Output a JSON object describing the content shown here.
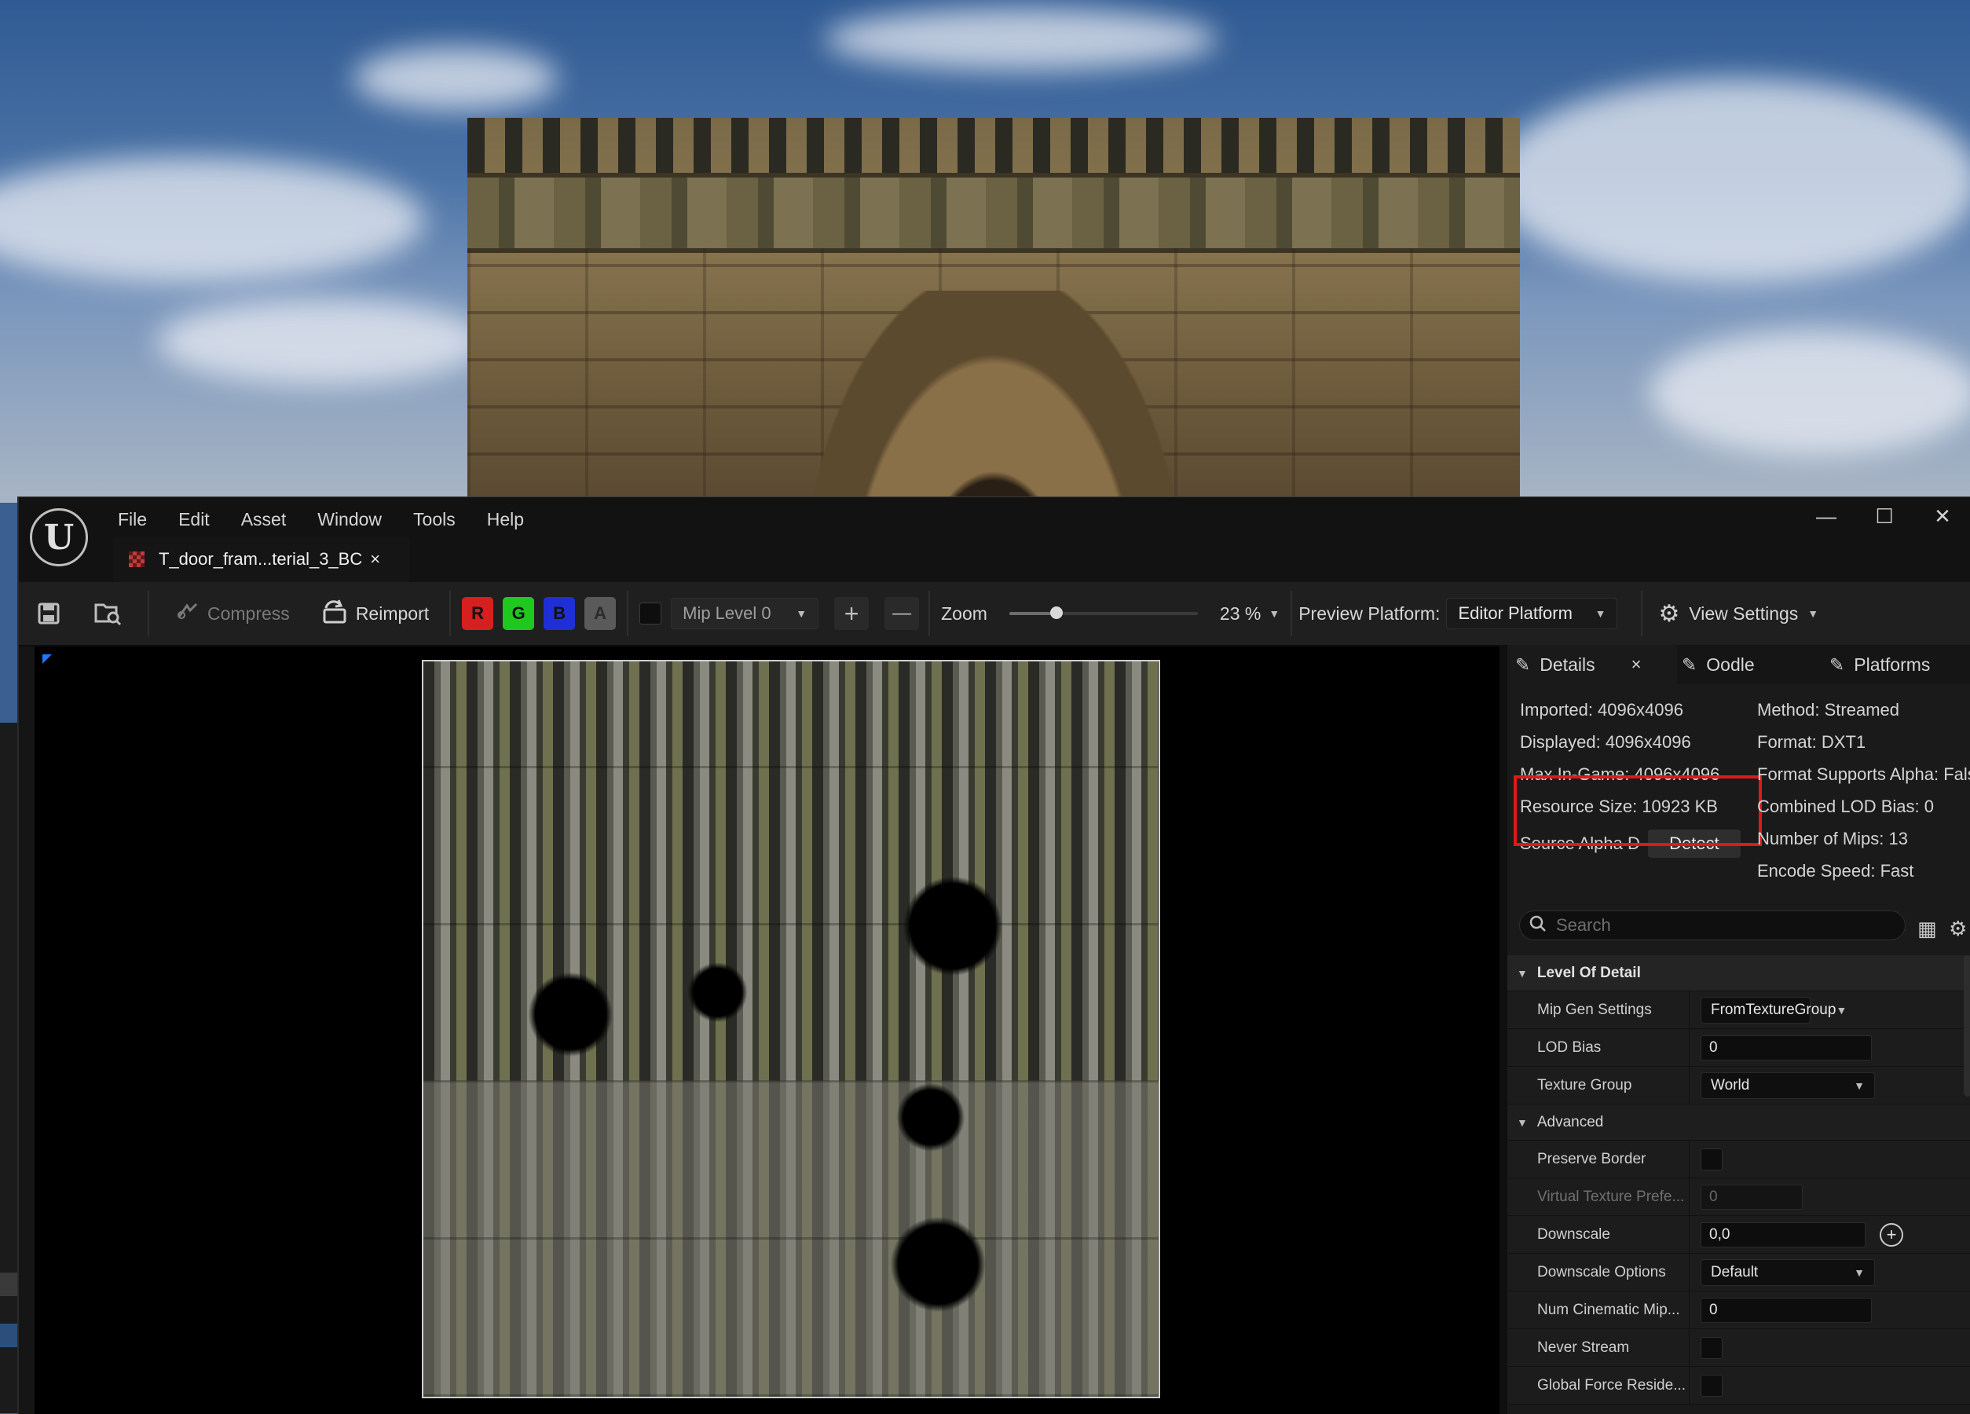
{
  "window": {
    "menu": [
      "File",
      "Edit",
      "Asset",
      "Window",
      "Tools",
      "Help"
    ],
    "controls": {
      "minimize": "—",
      "maximize": "☐",
      "close": "✕"
    }
  },
  "document_tab": {
    "label": "T_door_fram...terial_3_BC",
    "close": "×"
  },
  "toolbar": {
    "compress_label": "Compress",
    "reimport_label": "Reimport",
    "channels": [
      {
        "label": "R",
        "color": "#d61f1f"
      },
      {
        "label": "G",
        "color": "#1fc81f"
      },
      {
        "label": "B",
        "color": "#1f2fd6"
      },
      {
        "label": "A",
        "color": "#5a5a5a"
      }
    ],
    "mip_level": "Mip Level 0",
    "plus": "+",
    "minus": "—",
    "zoom_label": "Zoom",
    "zoom_slider_fraction": 0.25,
    "zoom_value": "23 %",
    "preview_platform_label": "Preview Platform:",
    "preview_platform_value": "Editor Platform",
    "view_settings_label": "View Settings"
  },
  "panel": {
    "tabs": [
      "Details",
      "Oodle",
      "Platforms"
    ],
    "tab_close": "×",
    "info_left": {
      "imported": "Imported: 4096x4096",
      "displayed": "Displayed: 4096x4096",
      "max_in_game": "Max In-Game: 4096x4096",
      "resource_size": "Resource Size: 10923 KB",
      "source_alpha": "Source Alpha D",
      "detect": "Detect"
    },
    "info_right": {
      "method": "Method: Streamed",
      "format": "Format: DXT1",
      "format_alpha": "Format Supports Alpha: False",
      "lod_bias": "Combined LOD Bias: 0",
      "mips": "Number of Mips: 13",
      "encode_speed": "Encode Speed: Fast"
    },
    "search_placeholder": "Search",
    "sections": {
      "lod": "Level Of Detail",
      "advanced": "Advanced"
    },
    "props": {
      "mip_gen_settings": {
        "name": "Mip Gen Settings",
        "value": "FromTextureGroup"
      },
      "lod_bias": {
        "name": "LOD Bias",
        "value": "0"
      },
      "texture_group": {
        "name": "Texture Group",
        "value": "World"
      },
      "preserve_border": {
        "name": "Preserve Border"
      },
      "virtual_texture_prefetch": {
        "name": "Virtual Texture Prefe...",
        "value": "0"
      },
      "downscale": {
        "name": "Downscale",
        "value": "0,0"
      },
      "downscale_options": {
        "name": "Downscale Options",
        "value": "Default"
      },
      "num_cinematic_mips": {
        "name": "Num Cinematic Mip...",
        "value": "0"
      },
      "never_stream": {
        "name": "Never Stream"
      },
      "global_force_resident": {
        "name": "Global Force Reside..."
      }
    }
  },
  "colors": {
    "highlight": "#e01818",
    "accent": "#1e78ff"
  }
}
